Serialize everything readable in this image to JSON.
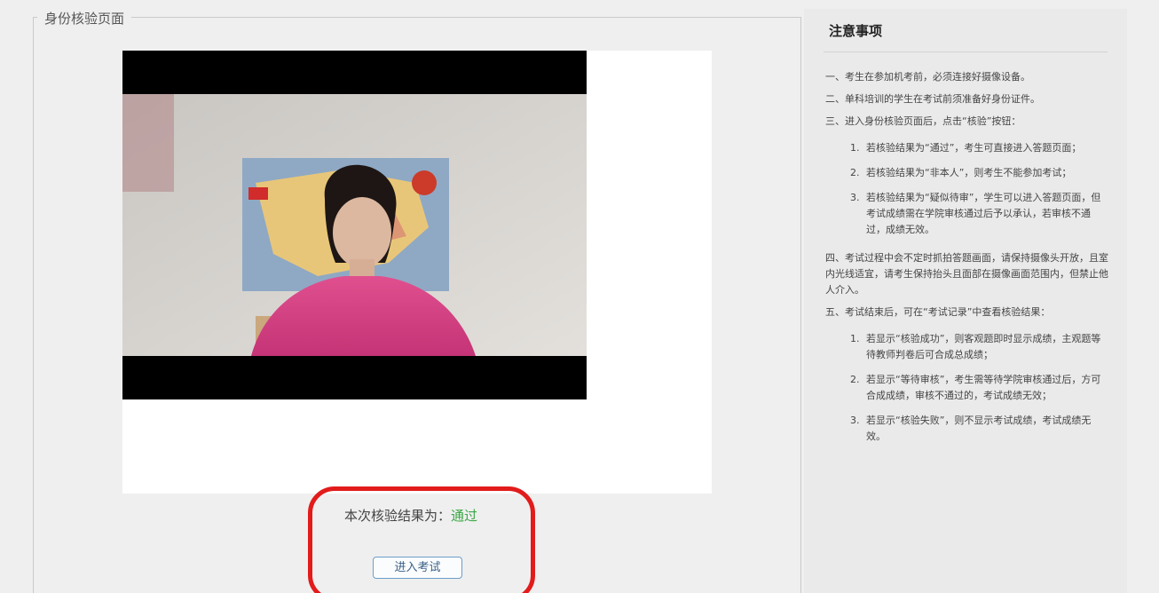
{
  "verify_section": {
    "legend": "身份核验页面",
    "result_prefix": "本次核验结果为：",
    "result_status": "通过",
    "enter_button": "进入考试"
  },
  "notes": {
    "title": "注意事项",
    "p1": "一、考生在参加机考前，必须连接好摄像设备。",
    "p2": "二、单科培训的学生在考试前须准备好身份证件。",
    "p3": "三、进入身份核验页面后，点击“核验”按钮：",
    "p3_items": [
      {
        "num": "1.",
        "text": "若核验结果为“通过”，考生可直接进入答题页面；"
      },
      {
        "num": "2.",
        "text": "若核验结果为“非本人”，则考生不能参加考试；"
      },
      {
        "num": "3.",
        "text": "若核验结果为“疑似待审”，学生可以进入答题页面，但考试成绩需在学院审核通过后予以承认，若审核不通过，成绩无效。"
      }
    ],
    "p4": "四、考试过程中会不定时抓拍答题画面，请保持摄像头开放，且室内光线适宜，请考生保持抬头且面部在摄像画面范围内，但禁止他人介入。",
    "p5": "五、考试结束后，可在“考试记录”中查看核验结果：",
    "p5_items": [
      {
        "num": "1.",
        "text": "若显示“核验成功”，则客观题即时显示成绩，主观题等待教师判卷后可合成总成绩；"
      },
      {
        "num": "2.",
        "text": "若显示“等待审核”，考生需等待学院审核通过后，方可合成成绩，审核不通过的，考试成绩无效；"
      },
      {
        "num": "3.",
        "text": "若显示“核验失败”，则不显示考试成绩，考试成绩无效。"
      }
    ]
  }
}
